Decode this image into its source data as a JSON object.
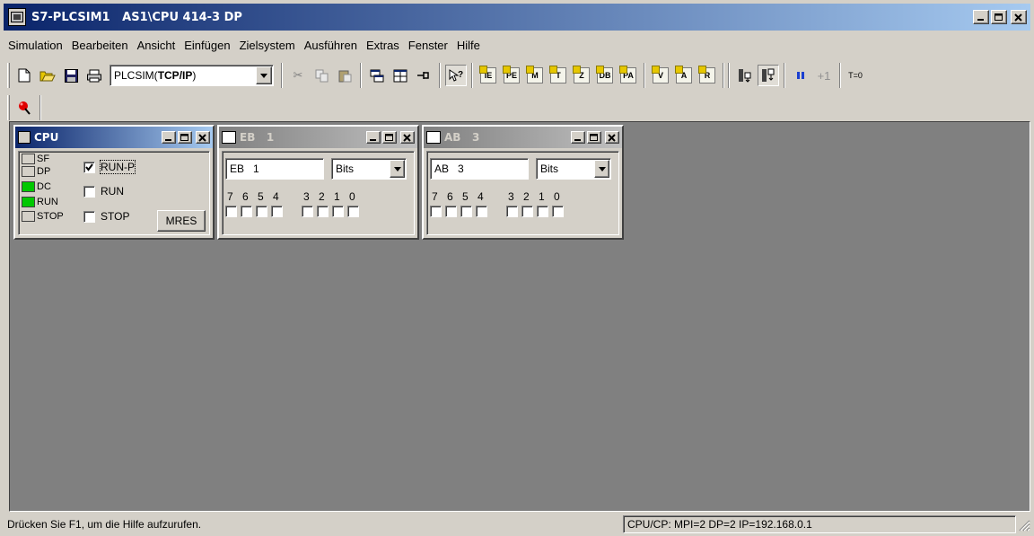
{
  "window": {
    "title": "S7-PLCSIM1   AS1\\CPU 414-3 DP"
  },
  "menu": [
    "Simulation",
    "Bearbeiten",
    "Ansicht",
    "Einfügen",
    "Zielsystem",
    "Ausführen",
    "Extras",
    "Fenster",
    "Hilfe"
  ],
  "toolbar": {
    "interface_prefix": "PLCSIM(",
    "interface_bold": "TCP/IP",
    "interface_suffix": ")",
    "step_label": "+1",
    "timer_label": "T=0",
    "icons": {
      "t1": "IE",
      "t2": "PE",
      "t3": "M",
      "t4": "T",
      "t5": "Z",
      "t6": "DB",
      "t7": "PA",
      "t8": "V",
      "t9": "A",
      "t10": "R"
    }
  },
  "cpu_window": {
    "title": "CPU",
    "leds": [
      {
        "label": "SF",
        "state": "off"
      },
      {
        "label": "DP",
        "state": "off"
      },
      {
        "label": "DC",
        "state": "on"
      },
      {
        "label": "RUN",
        "state": "on"
      },
      {
        "label": "STOP",
        "state": "off"
      }
    ],
    "modes": [
      {
        "label": "RUN-P",
        "checked": true
      },
      {
        "label": "RUN",
        "checked": false
      },
      {
        "label": "STOP",
        "checked": false
      }
    ],
    "mres_label": "MRES"
  },
  "io_windows": [
    {
      "title_prefix": "EB",
      "title_num": "1",
      "address": "EB   1",
      "format": "Bits",
      "bits_left": [
        "7",
        "6",
        "5",
        "4"
      ],
      "bits_right": [
        "3",
        "2",
        "1",
        "0"
      ]
    },
    {
      "title_prefix": "AB",
      "title_num": "3",
      "address": "AB   3",
      "format": "Bits",
      "bits_left": [
        "7",
        "6",
        "5",
        "4"
      ],
      "bits_right": [
        "3",
        "2",
        "1",
        "0"
      ]
    }
  ],
  "status": {
    "help": "Drücken Sie F1, um die Hilfe aufzurufen.",
    "connection": "CPU/CP:  MPI=2 DP=2 IP=192.168.0.1"
  },
  "colors": {
    "title_active": "#0a246a",
    "title_gradient_end": "#a6caf0",
    "led_on": "#00c800",
    "mdi_bg": "#808080",
    "face": "#d4d0c8"
  }
}
